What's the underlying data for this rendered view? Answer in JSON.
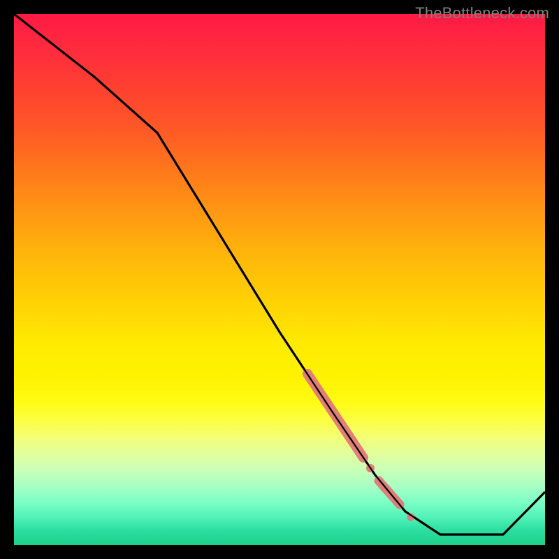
{
  "watermark": "TheBottleneck.com",
  "chart_data": {
    "type": "line",
    "title": "",
    "xlabel": "",
    "ylabel": "",
    "x": [
      0.0,
      0.15,
      0.27,
      0.5,
      0.6,
      0.68,
      0.74,
      0.8,
      0.92,
      1.0
    ],
    "values": [
      1.0,
      0.88,
      0.78,
      0.4,
      0.25,
      0.13,
      0.06,
      0.02,
      0.02,
      0.1
    ],
    "xlim": [
      0,
      1
    ],
    "ylim": [
      0,
      1
    ],
    "highlight_segments": [
      {
        "x_start": 0.55,
        "x_end": 0.66,
        "style": "thick"
      },
      {
        "x_start": 0.69,
        "x_end": 0.73,
        "style": "thick"
      },
      {
        "x_start": 0.67,
        "x_end": 0.68,
        "style": "dot"
      },
      {
        "x_start": 0.75,
        "x_end": 0.76,
        "style": "dot"
      }
    ],
    "highlight_color": "#e27878",
    "background_gradient": {
      "top": "#ff1a44",
      "mid": "#ffee00",
      "bottom": "#1cd08c"
    }
  }
}
